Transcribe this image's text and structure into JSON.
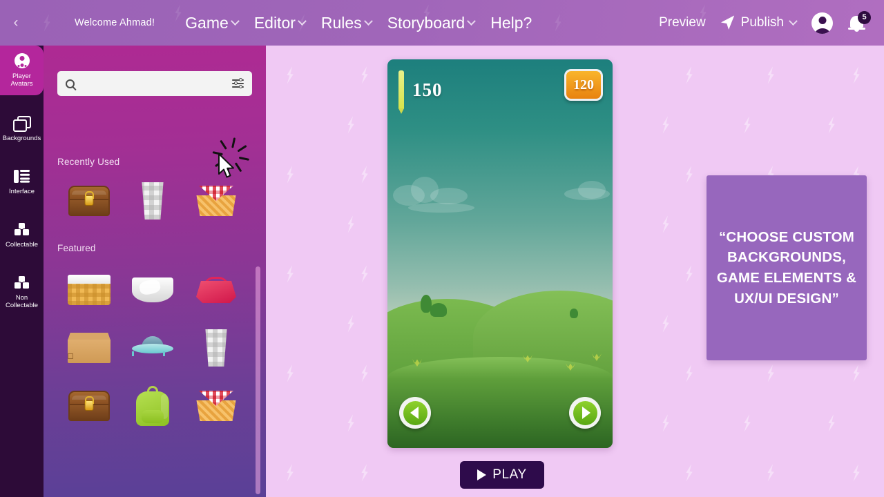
{
  "header": {
    "back_icon": "chevron-left-icon",
    "welcome": "Welcome Ahmad!",
    "nav": [
      {
        "label": "Game",
        "has_caret": true
      },
      {
        "label": "Editor",
        "has_caret": true
      },
      {
        "label": "Rules",
        "has_caret": true
      },
      {
        "label": "Storyboard",
        "has_caret": true
      },
      {
        "label": "Help?",
        "has_caret": false
      }
    ],
    "preview_label": "Preview",
    "publish_label": "Publish",
    "publish_icon": "send-icon",
    "avatar_icon": "user-avatar-icon",
    "bell_icon": "notification-bell-icon",
    "notification_count": "5",
    "bg_color": "#a066b9"
  },
  "sidebar": {
    "items": [
      {
        "label": "Player\nAvatars",
        "label_line1": "Player",
        "label_line2": "Avatars",
        "icon": "person-icon",
        "active": true
      },
      {
        "label": "Backgrounds",
        "label_line1": "Backgrounds",
        "label_line2": "",
        "icon": "layers-icon",
        "active": false
      },
      {
        "label": "Interface",
        "label_line1": "Interface",
        "label_line2": "",
        "icon": "layout-icon",
        "active": false
      },
      {
        "label": "Collectable",
        "label_line1": "Collectable",
        "label_line2": "",
        "icon": "cubes-icon",
        "active": false
      },
      {
        "label": "Non\nCollectable",
        "label_line1": "Non",
        "label_line2": "Collectable",
        "icon": "cubes-icon",
        "active": false
      }
    ],
    "active_color": "#b4269c",
    "bg_color": "#2d0b38"
  },
  "panel": {
    "search": {
      "placeholder": "",
      "value": "",
      "search_icon": "search-icon",
      "filter_icon": "filter-sliders-icon"
    },
    "sections": [
      {
        "title": "Recently Used"
      },
      {
        "title": "Featured"
      }
    ],
    "recently_used": [
      {
        "name": "treasure-chest"
      },
      {
        "name": "plaid-glass"
      },
      {
        "name": "picnic-basket"
      }
    ],
    "featured": [
      {
        "name": "basket-with-cloth"
      },
      {
        "name": "white-bowl"
      },
      {
        "name": "red-purse"
      },
      {
        "name": "cardboard-box"
      },
      {
        "name": "ufo"
      },
      {
        "name": "plaid-glass"
      },
      {
        "name": "treasure-chest"
      },
      {
        "name": "green-backpack"
      },
      {
        "name": "picnic-basket"
      }
    ],
    "gradient_top": "#ae2a93",
    "gradient_bottom": "#5a4097"
  },
  "game_preview": {
    "score": "150",
    "score_icon": "pencil-icon",
    "coins": "120",
    "prev_icon": "arrow-left-circle-icon",
    "next_icon": "arrow-right-circle-icon"
  },
  "play_button": {
    "label": "PLAY",
    "icon": "play-triangle-icon"
  },
  "quote_card": {
    "text": "“CHOOSE CUSTOM BACKGROUNDS, GAME ELEMENTS & UX/UI DESIGN”",
    "bg_color": "#9767bd"
  },
  "canvas": {
    "bg_color": "#f0c9f4",
    "pattern": "lightning-bolt"
  },
  "cursor": {
    "icon": "mouse-pointer-icon",
    "state": "click-burst"
  }
}
